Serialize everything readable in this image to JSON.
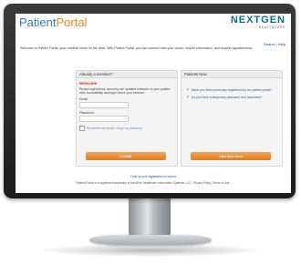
{
  "header": {
    "logo_prefix": "Patient",
    "logo_suffix": "Portal",
    "vendor_logo": "NEXTGEN",
    "vendor_tagline": "HEALTHCARE"
  },
  "topnav": {
    "search": "Search",
    "help": "Help"
  },
  "intro_text": "Welcome to Patient Portal, your medical home on the Web. With Patient Portal, you can connect with your doctor, helpful information, and request appointments.",
  "login": {
    "panel_title": "Already a member?",
    "welcome": "Welcome",
    "description": "Please login below, securely use updated software on your patient visit. Accessibility and login check your browser.",
    "email_label": "Email",
    "password_label": "Password",
    "remember_label": "Remember my email. I forgot my password.",
    "button_label": "LOGIN"
  },
  "new_user": {
    "panel_title": "Patients New",
    "bullet1": "Have you been previously registered for our patient portal?",
    "bullet2": "Do you have a temporary password and username?",
    "button_label": "I am new here"
  },
  "footer_link": "Look up your registration on record",
  "footer_text": "Patient Portal is a registered trademark of NextGen Healthcare Information Systems, LLC. Privacy Policy, Terms of Use."
}
